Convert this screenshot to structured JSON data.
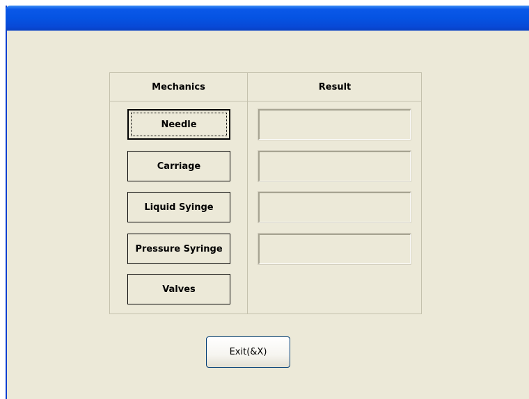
{
  "window": {
    "title": "",
    "titlebar_color": "#0553e2",
    "background_color": "#ece9d8"
  },
  "table": {
    "headers": {
      "mechanics": "Mechanics",
      "result": "Result"
    },
    "mechanics_buttons": [
      {
        "label": "Needle",
        "focused": true
      },
      {
        "label": "Carriage",
        "focused": false
      },
      {
        "label": "Liquid Syinge",
        "focused": false
      },
      {
        "label": "Pressure Syringe",
        "focused": false
      },
      {
        "label": "Valves",
        "focused": false
      }
    ],
    "results": [
      "",
      "",
      "",
      ""
    ]
  },
  "footer": {
    "exit_label": "Exit(&X)"
  }
}
